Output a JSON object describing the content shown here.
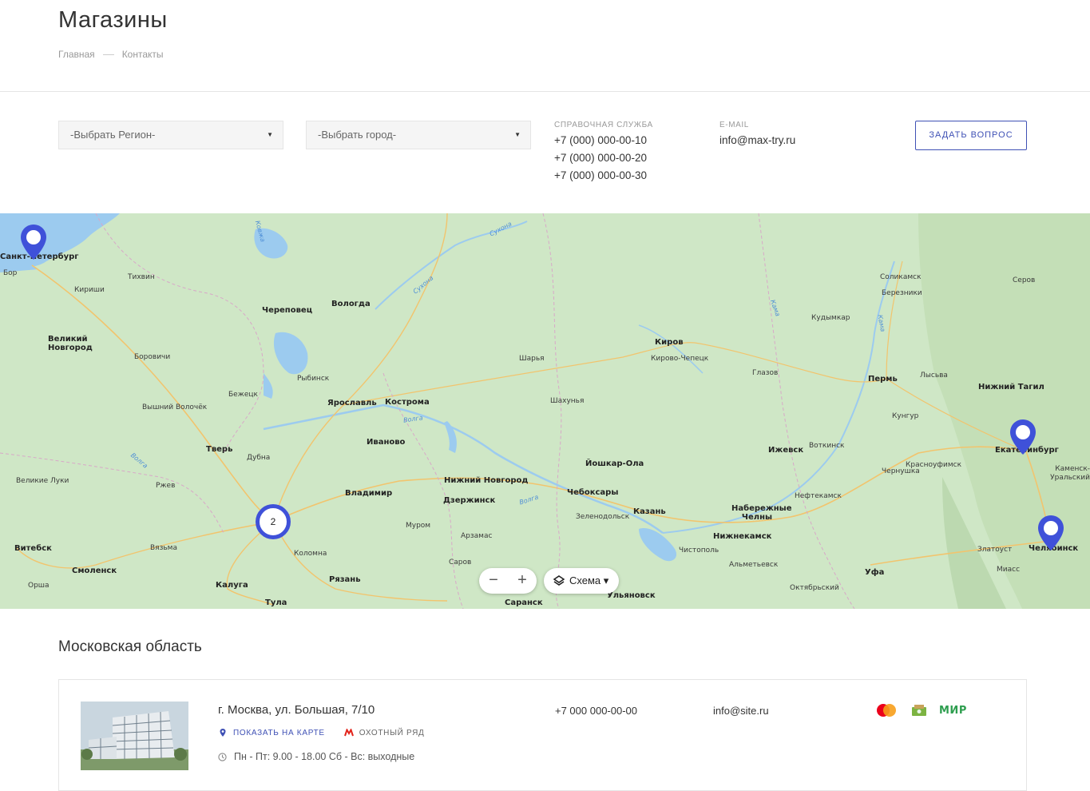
{
  "page": {
    "title": "Магазины",
    "breadcrumb": [
      "Главная",
      "Контакты"
    ]
  },
  "filters": {
    "region_select": "-Выбрать Регион-",
    "city_select": "-Выбрать город-",
    "help_label": "СПРАВОЧНАЯ СЛУЖБА",
    "phones": [
      "+7 (000) 000-00-10",
      "+7 (000) 000-00-20",
      "+7 (000) 000-00-30"
    ],
    "email_label": "E-MAIL",
    "email": "info@max-try.ru",
    "ask_button": "ЗАДАТЬ ВОПРОС"
  },
  "map": {
    "zoom_out": "−",
    "zoom_in": "+",
    "layer_button": "Схема ▾",
    "cluster_count": "2",
    "cities": [
      {
        "name": "Санкт-Петербург",
        "big": true
      },
      {
        "name": "Бор"
      },
      {
        "name": "Тихвин"
      },
      {
        "name": "Кириши"
      },
      {
        "name": "Череповец",
        "big": true
      },
      {
        "name": "Вологда",
        "big": true
      },
      {
        "name": "Великий Новгород",
        "big": true
      },
      {
        "name": "Боровичи"
      },
      {
        "name": "Рыбинск"
      },
      {
        "name": "Бежецк"
      },
      {
        "name": "Вышний Волочёк"
      },
      {
        "name": "Ярославль",
        "big": true
      },
      {
        "name": "Кострома",
        "big": true
      },
      {
        "name": "Иваново",
        "big": true
      },
      {
        "name": "Тверь",
        "big": true
      },
      {
        "name": "Дубна"
      },
      {
        "name": "Великие Луки"
      },
      {
        "name": "Ржев"
      },
      {
        "name": "Владимир",
        "big": true
      },
      {
        "name": "Нижний Новгород",
        "big": true
      },
      {
        "name": "Дзержинск",
        "big": true
      },
      {
        "name": "Муром"
      },
      {
        "name": "Арзамас"
      },
      {
        "name": "Саров"
      },
      {
        "name": "Витебск",
        "big": true
      },
      {
        "name": "Смоленск",
        "big": true
      },
      {
        "name": "Вязьма"
      },
      {
        "name": "Коломна"
      },
      {
        "name": "Калуга",
        "big": true
      },
      {
        "name": "Рязань",
        "big": true
      },
      {
        "name": "Тула",
        "big": true
      },
      {
        "name": "Орша"
      },
      {
        "name": "Шарья"
      },
      {
        "name": "Шахунья"
      },
      {
        "name": "Киров",
        "big": true
      },
      {
        "name": "Кирово-Чепецк"
      },
      {
        "name": "Йошкар-Ола",
        "big": true
      },
      {
        "name": "Чебоксары",
        "big": true
      },
      {
        "name": "Зеленодольск"
      },
      {
        "name": "Казань",
        "big": true
      },
      {
        "name": "Ульяновск",
        "big": true
      },
      {
        "name": "Саранск",
        "big": true
      },
      {
        "name": "Глазов"
      },
      {
        "name": "Ижевск",
        "big": true
      },
      {
        "name": "Воткинск"
      },
      {
        "name": "Набережные Челны",
        "big": true
      },
      {
        "name": "Нижнекамск",
        "big": true
      },
      {
        "name": "Чистополь"
      },
      {
        "name": "Альметьевск"
      },
      {
        "name": "Нефтекамск"
      },
      {
        "name": "Октябрьский"
      },
      {
        "name": "Уфа",
        "big": true
      },
      {
        "name": "Пермь",
        "big": true
      },
      {
        "name": "Кунгур"
      },
      {
        "name": "Лысьва"
      },
      {
        "name": "Чернушка"
      },
      {
        "name": "Красноуфимск"
      },
      {
        "name": "Соликамск"
      },
      {
        "name": "Березники"
      },
      {
        "name": "Кудымкар"
      },
      {
        "name": "Серов"
      },
      {
        "name": "Нижний Тагил",
        "big": true
      },
      {
        "name": "Екатеринбург",
        "big": true
      },
      {
        "name": "Каменск-Уральский"
      },
      {
        "name": "Златоуст"
      },
      {
        "name": "Миасс"
      },
      {
        "name": "Челябинск",
        "big": true
      }
    ],
    "rivers": [
      "Сухона",
      "Сухона",
      "Волга",
      "Волга",
      "Волга",
      "Кама",
      "Кама",
      "Ковжа"
    ]
  },
  "region": {
    "title": "Московская область"
  },
  "store": {
    "address": "г. Москва, ул. Большая, 7/10",
    "show_on_map": "ПОКАЗАТЬ НА КАРТЕ",
    "metro": "ОХОТНЫЙ РЯД",
    "hours": "Пн - Пт: 9.00 - 18.00 Сб - Вс: выходные",
    "phone": "+7 000 000-00-00",
    "email": "info@site.ru",
    "payments": [
      "mastercard-icon",
      "cash-icon",
      "mir-icon"
    ],
    "mir_text": "МИР"
  },
  "colors": {
    "accent": "#3f51b5",
    "pin": "#3f51d9",
    "map_land": "#cfe7c6",
    "map_water": "#9ccbef",
    "metro": "#e2231a"
  }
}
